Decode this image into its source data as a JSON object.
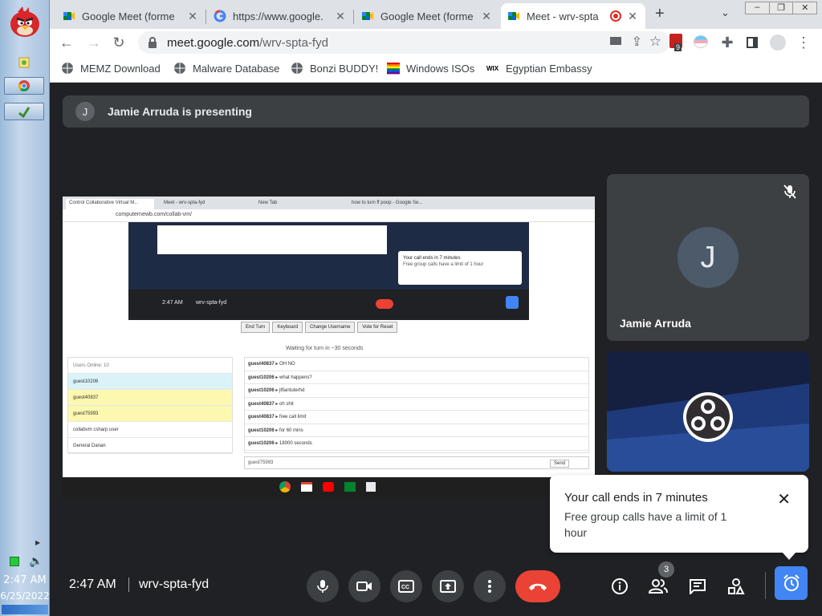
{
  "taskbar": {
    "clock_time": "2:47 AM",
    "clock_date": "6/25/2022"
  },
  "browser": {
    "tabs": [
      {
        "title": "Google Meet (forme",
        "favicon": "meet-icon",
        "active": false
      },
      {
        "title": "https://www.google.",
        "favicon": "google-icon",
        "active": false
      },
      {
        "title": "Google Meet (forme",
        "favicon": "meet-icon",
        "active": false
      },
      {
        "title": "Meet - wrv-spta",
        "favicon": "meet-icon",
        "active": true
      }
    ],
    "url_host": "meet.google.com",
    "url_path": "/wrv-spta-fyd",
    "extension_badge": "9",
    "bookmarks": [
      {
        "label": "MEMZ Download",
        "icon": "globe-icon"
      },
      {
        "label": "Malware Database",
        "icon": "globe-icon"
      },
      {
        "label": "Bonzi BUDDY!",
        "icon": "globe-icon"
      },
      {
        "label": "Windows ISOs",
        "icon": "rainbow-flag-icon"
      },
      {
        "label": "Egyptian Embassy",
        "icon": "wix-icon"
      }
    ]
  },
  "meet": {
    "presenting_initial": "J",
    "presenting_text": "Jamie Arruda is presenting",
    "participant1_initial": "J",
    "participant1_name": "Jamie Arruda",
    "toast_title": "Your call ends in 7 minutes",
    "toast_body": "Free group calls have a limit of 1 hour",
    "time": "2:47 AM",
    "meeting_code": "wrv-spta-fyd",
    "people_count": "3"
  },
  "shared_screen": {
    "tabs": [
      "Control Collaborative Virtual M...",
      "Meet - wrv-spta-fyd",
      "New Tab",
      "how to turn ff poop - Google Se..."
    ],
    "url": "computernewb.com/collab-vm/",
    "vm_time": "2:47 AM",
    "vm_code": "wrv-spta-fyd",
    "vm_toast_title": "Your call ends in 7 minutes",
    "vm_toast_body": "Free group calls have a limit of 1 hour",
    "buttons": [
      "End Turn",
      "Keyboard",
      "Change Username",
      "Vote for Reset"
    ],
    "waiting": "Waiting for turn in ~30 seconds",
    "users_header": "Users Online: 10",
    "users": [
      "guest10206",
      "guest40837",
      "guest75993",
      "collabvm csharp user",
      "General Danan"
    ],
    "chat": [
      {
        "user": "guest40837",
        "msg": "OH NO"
      },
      {
        "user": "guest10206",
        "msg": "what happens?"
      },
      {
        "user": "guest10206",
        "msg": "jtfiantuterhd"
      },
      {
        "user": "guest40837",
        "msg": "oh shit"
      },
      {
        "user": "guest40837",
        "msg": "free call limit"
      },
      {
        "user": "guest10206",
        "msg": "for 60 mins"
      },
      {
        "user": "guest10206",
        "msg": "18000 seconds"
      }
    ],
    "chat_name": "guest75993",
    "send_label": "Send"
  }
}
